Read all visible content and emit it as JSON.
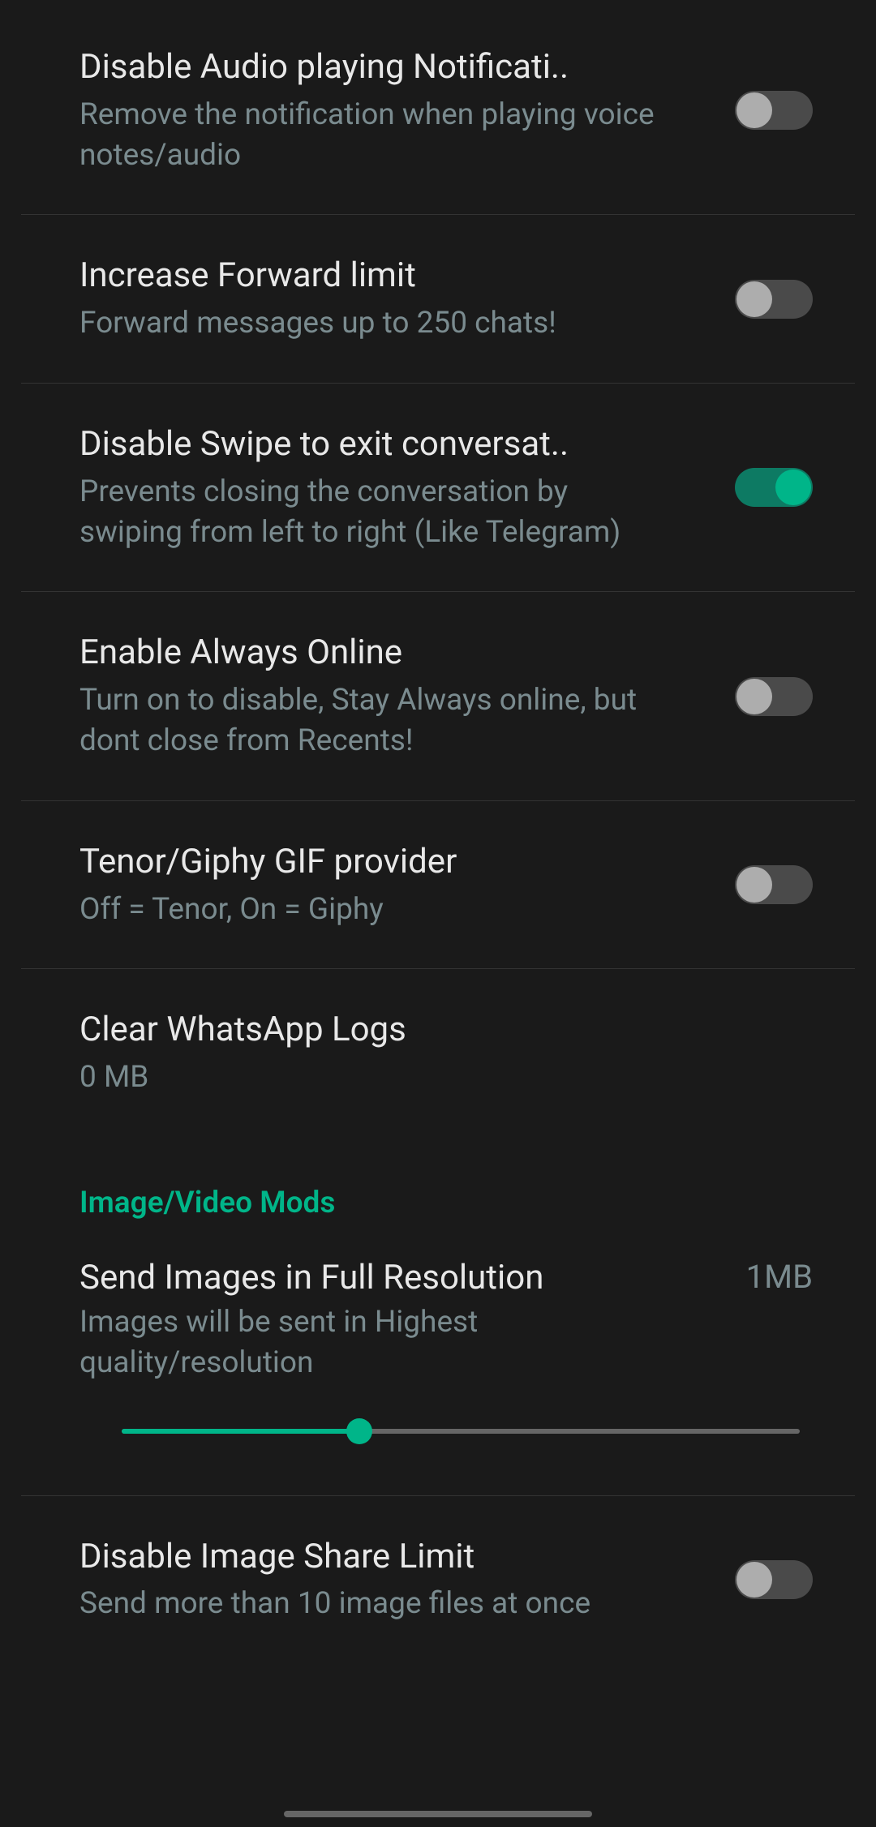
{
  "settings": {
    "audio_notif": {
      "title": "Disable Audio playing Notificati..",
      "subtitle": "Remove the notification when playing voice notes/audio",
      "enabled": false
    },
    "forward_limit": {
      "title": "Increase Forward limit",
      "subtitle": "Forward messages up to 250 chats!",
      "enabled": false
    },
    "swipe_exit": {
      "title": "Disable Swipe to exit conversat..",
      "subtitle": "Prevents closing the conversation by swiping from left to right (Like Telegram)",
      "enabled": true
    },
    "always_online": {
      "title": "Enable Always Online",
      "subtitle": "Turn on to disable, Stay Always online, but dont close from Recents!",
      "enabled": false
    },
    "gif_provider": {
      "title": "Tenor/Giphy GIF provider",
      "subtitle": "Off = Tenor, On = Giphy",
      "enabled": false
    },
    "clear_logs": {
      "title": "Clear WhatsApp Logs",
      "subtitle": "0 MB"
    }
  },
  "section_header": "Image/Video Mods",
  "image_resolution": {
    "title": "Send Images in Full Resolution",
    "subtitle": "Images will be sent in Highest quality/resolution",
    "value": "1MB"
  },
  "image_share_limit": {
    "title": "Disable Image Share Limit",
    "subtitle": "Send more than 10 image files at once",
    "enabled": false
  }
}
